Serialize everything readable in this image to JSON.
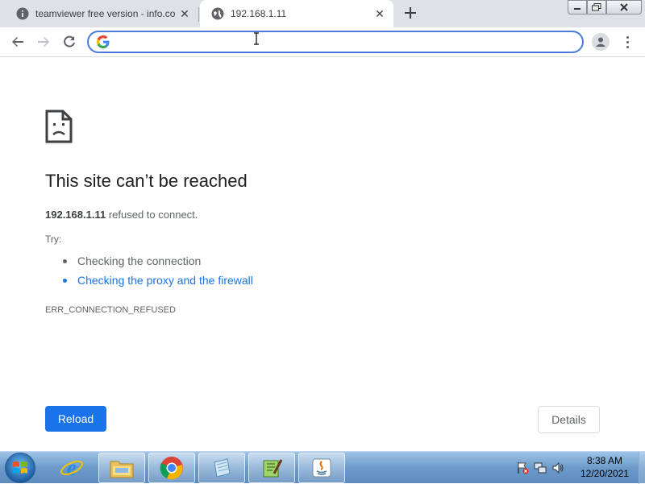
{
  "browser": {
    "tabs": [
      {
        "title": "teamviewer free version - info.co",
        "icon": "info-icon",
        "active": false
      },
      {
        "title": "192.168.1.11",
        "icon": "globe-icon",
        "active": true
      }
    ],
    "new_tab_icon": "plus-icon",
    "omnibox": {
      "value": "",
      "placeholder": ""
    },
    "toolbar_icons": [
      "back-arrow-icon",
      "forward-arrow-icon",
      "reload-icon",
      "google-icon",
      "profile-icon",
      "menu-dots-icon"
    ]
  },
  "error_page": {
    "heading": "This site can’t be reached",
    "host": "192.168.1.11",
    "message_suffix": "refused to connect.",
    "try_label": "Try:",
    "suggestions": [
      {
        "text": "Checking the connection",
        "is_link": false
      },
      {
        "text": "Checking the proxy and the firewall",
        "is_link": true
      }
    ],
    "error_code": "ERR_CONNECTION_REFUSED",
    "reload_label": "Reload",
    "details_label": "Details"
  },
  "taskbar": {
    "apps": [
      "ie-icon",
      "explorer-folder-icon",
      "chrome-icon",
      "notepad-icon",
      "notepad-plus-icon",
      "java-icon"
    ],
    "clock_time": "8:38 AM",
    "clock_date": "12/20/2021"
  },
  "colors": {
    "accent": "#1a73e8",
    "tabstrip": "#dee1e6",
    "omnibox_focus": "#4a7bd6"
  }
}
